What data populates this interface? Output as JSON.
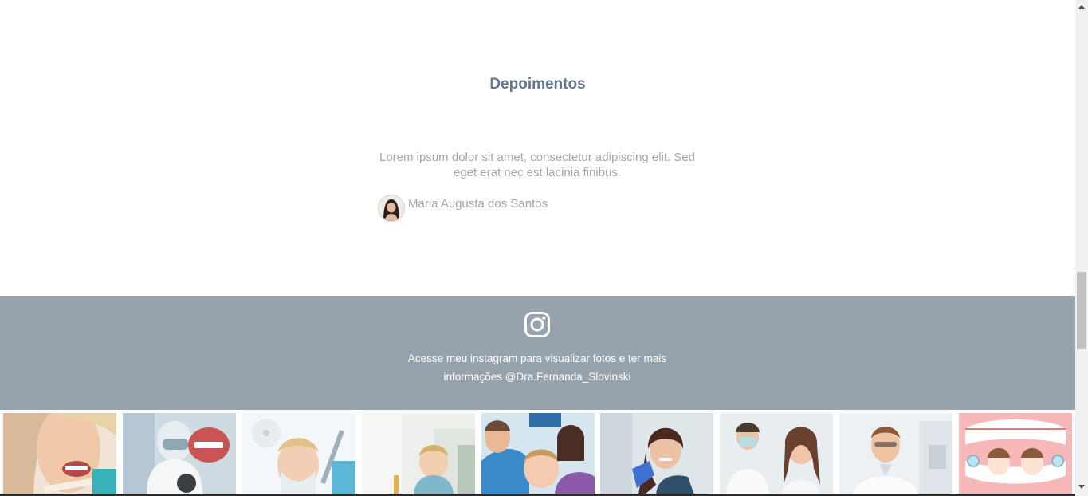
{
  "testimonials": {
    "title": "Depoimentos",
    "quote": "Lorem ipsum dolor sit amet, consectetur adipiscing elit. Sed eget erat nec est lacinia finibus.",
    "author_name": "Maria Augusta dos Santos"
  },
  "instagram": {
    "icon": "instagram-icon",
    "text": "Acesse meu instagram para visualizar fotos e ter mais informações @Dra.Fernanda_Slovinski"
  },
  "photos": [
    {
      "subject": "woman-teeth-shade-guide"
    },
    {
      "subject": "dentist-denture-model"
    },
    {
      "subject": "masked-dentist"
    },
    {
      "subject": "girl-dental-chair"
    },
    {
      "subject": "child-dentist-visit"
    },
    {
      "subject": "smiling-patient-dentist"
    },
    {
      "subject": "dentist-and-patient"
    },
    {
      "subject": "smiling-dentist"
    },
    {
      "subject": "cartoon-teeth-braces"
    }
  ],
  "colors": {
    "title": "#64778e",
    "muted_text": "#a6a6a6",
    "instagram_band": "#96a2ac",
    "band_text": "#ffffff"
  }
}
